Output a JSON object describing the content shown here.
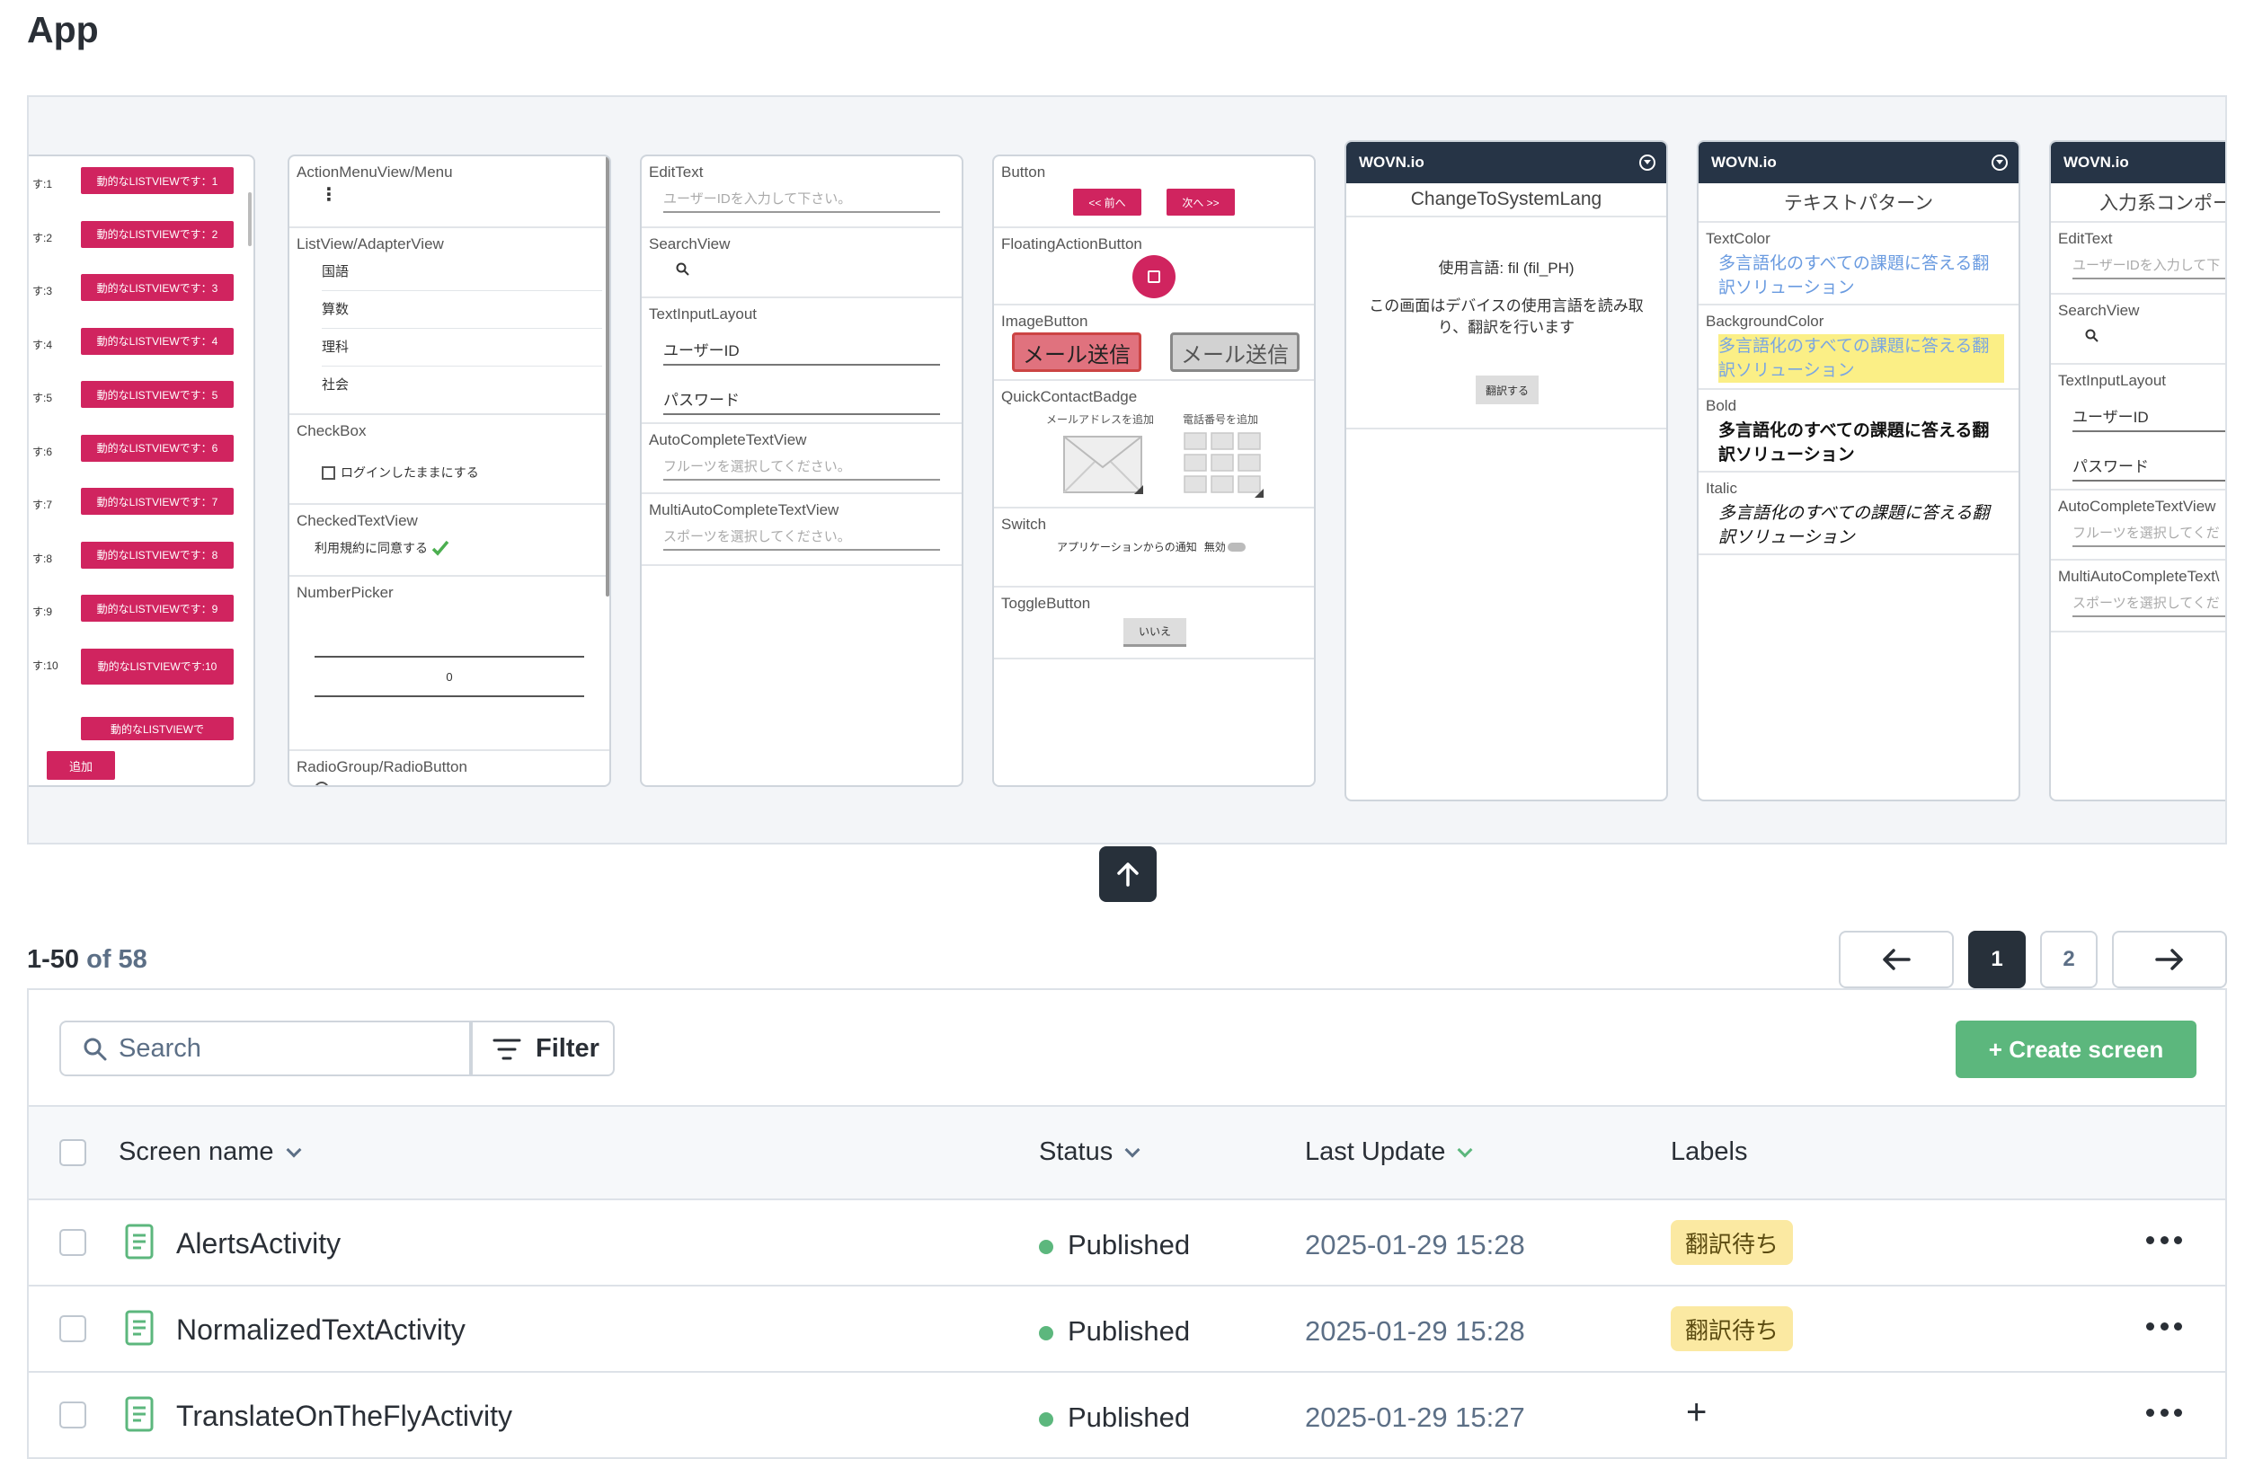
{
  "page": {
    "title": "App"
  },
  "previews": {
    "list_card": {
      "items": [
        {
          "prefix": "す:1",
          "button": "動的なLISTVIEWです：1"
        },
        {
          "prefix": "す:2",
          "button": "動的なLISTVIEWです：2"
        },
        {
          "prefix": "す:3",
          "button": "動的なLISTVIEWです：3"
        },
        {
          "prefix": "す:4",
          "button": "動的なLISTVIEWです：4"
        },
        {
          "prefix": "す:5",
          "button": "動的なLISTVIEWです：5"
        },
        {
          "prefix": "す:6",
          "button": "動的なLISTVIEWです：6"
        },
        {
          "prefix": "す:7",
          "button": "動的なLISTVIEWです：7"
        },
        {
          "prefix": "す:8",
          "button": "動的なLISTVIEWです：8"
        },
        {
          "prefix": "す:9",
          "button": "動的なLISTVIEWです：9"
        },
        {
          "prefix": "す:10",
          "button": "動的なLISTVIEWです:10"
        }
      ],
      "partial_button": "動的なLISTVIEWで",
      "add_button": "追加"
    },
    "menu_card": {
      "action_menu_label": "ActionMenuView/Menu",
      "listview_label": "ListView/AdapterView",
      "list_items": [
        "国語",
        "算数",
        "理科",
        "社会"
      ],
      "checkbox_label": "CheckBox",
      "checkbox_text": "ログインしたままにする",
      "checked_label": "CheckedTextView",
      "checked_text": "利用規約に同意する",
      "numberpicker_label": "NumberPicker",
      "numberpicker_value": "0",
      "radio_label": "RadioGroup/RadioButton"
    },
    "edit_card": {
      "edittext_label": "EditText",
      "edittext_placeholder": "ユーザーIDを入力して下さい。",
      "searchview_label": "SearchView",
      "textinput_label": "TextInputLayout",
      "userid_value": "ユーザーID",
      "password_value": "パスワード",
      "autocomplete_label": "AutoCompleteTextView",
      "autocomplete_placeholder": "フルーツを選択してください。",
      "multiauto_label": "MultiAutoCompleteTextView",
      "multiauto_placeholder": "スポーツを選択してください。"
    },
    "button_card": {
      "button_label": "Button",
      "prev_button": "<< 前へ",
      "next_button": "次へ >>",
      "fab_label": "FloatingActionButton",
      "imagebutton_label": "ImageButton",
      "send_button_1": "メール送信",
      "send_button_2": "メール送信",
      "quickcontact_label": "QuickContactBadge",
      "add_email": "メールアドレスを追加",
      "add_phone": "電話番号を追加",
      "switch_label": "Switch",
      "switch_text": "アプリケーションからの通知",
      "switch_state": "無効",
      "toggle_label": "ToggleButton",
      "toggle_value": "いいえ"
    },
    "wovn_card_1": {
      "brand": "WOVN.io",
      "title": "ChangeToSystemLang",
      "lang_text": "使用言語: fil (fil_PH)",
      "desc": "この画面はデバイスの使用言語を読み取り、翻訳を行います",
      "translate_button": "翻訳する"
    },
    "wovn_card_2": {
      "brand": "WOVN.io",
      "title": "テキストパターン",
      "textcolor_label": "TextColor",
      "textcolor_text": "多言語化のすべての課題に答える翻訳ソリューション",
      "bgcolor_label": "BackgroundColor",
      "bgcolor_text": "多言語化のすべての課題に答える翻訳ソリューション",
      "bold_label": "Bold",
      "bold_text": "多言語化のすべての課題に答える翻訳ソリューション",
      "italic_label": "Italic",
      "italic_text": "多言語化のすべての課題に答える翻訳ソリューション"
    },
    "wovn_card_3": {
      "brand": "WOVN.io",
      "title": "入力系コンポー",
      "edittext_label": "EditText",
      "edittext_placeholder": "ユーザーIDを入力して下",
      "searchview_label": "SearchView",
      "textinput_label": "TextInputLayout",
      "userid_value": "ユーザーID",
      "password_value": "パスワード",
      "autocomplete_label": "AutoCompleteTextView",
      "autocomplete_placeholder": "フルーツを選択してくだ",
      "multiauto_label": "MultiAutoCompleteText\\",
      "multiauto_placeholder": "スポーツを選択してくだ"
    }
  },
  "pagination": {
    "range": "1-50",
    "of_label": "of 58",
    "pages": [
      "1",
      "2"
    ],
    "current": "1"
  },
  "toolbar": {
    "search_placeholder": "Search",
    "filter_label": "Filter",
    "create_label": "+ Create screen"
  },
  "table": {
    "columns": {
      "name": "Screen name",
      "status": "Status",
      "last_update": "Last Update",
      "labels": "Labels"
    },
    "rows": [
      {
        "name": "AlertsActivity",
        "status": "Published",
        "date": "2025-01-29 15:28",
        "label": "翻訳待ち"
      },
      {
        "name": "NormalizedTextActivity",
        "status": "Published",
        "date": "2025-01-29 15:28",
        "label": "翻訳待ち"
      },
      {
        "name": "TranslateOnTheFlyActivity",
        "status": "Published",
        "date": "2025-01-29 15:27",
        "label": "+"
      }
    ]
  },
  "colors": {
    "accent_green": "#5cb77d",
    "wovn_header": "#263446",
    "pink": "#d0245f",
    "label_bg": "#fbe9a2"
  },
  "icons": [
    "arrow-up-icon",
    "arrow-left-icon",
    "arrow-right-icon",
    "search-icon",
    "filter-icon",
    "document-icon",
    "more-icon",
    "chevron-down-icon",
    "globe-icon",
    "checkmark-icon",
    "envelope-icon",
    "keypad-icon"
  ]
}
